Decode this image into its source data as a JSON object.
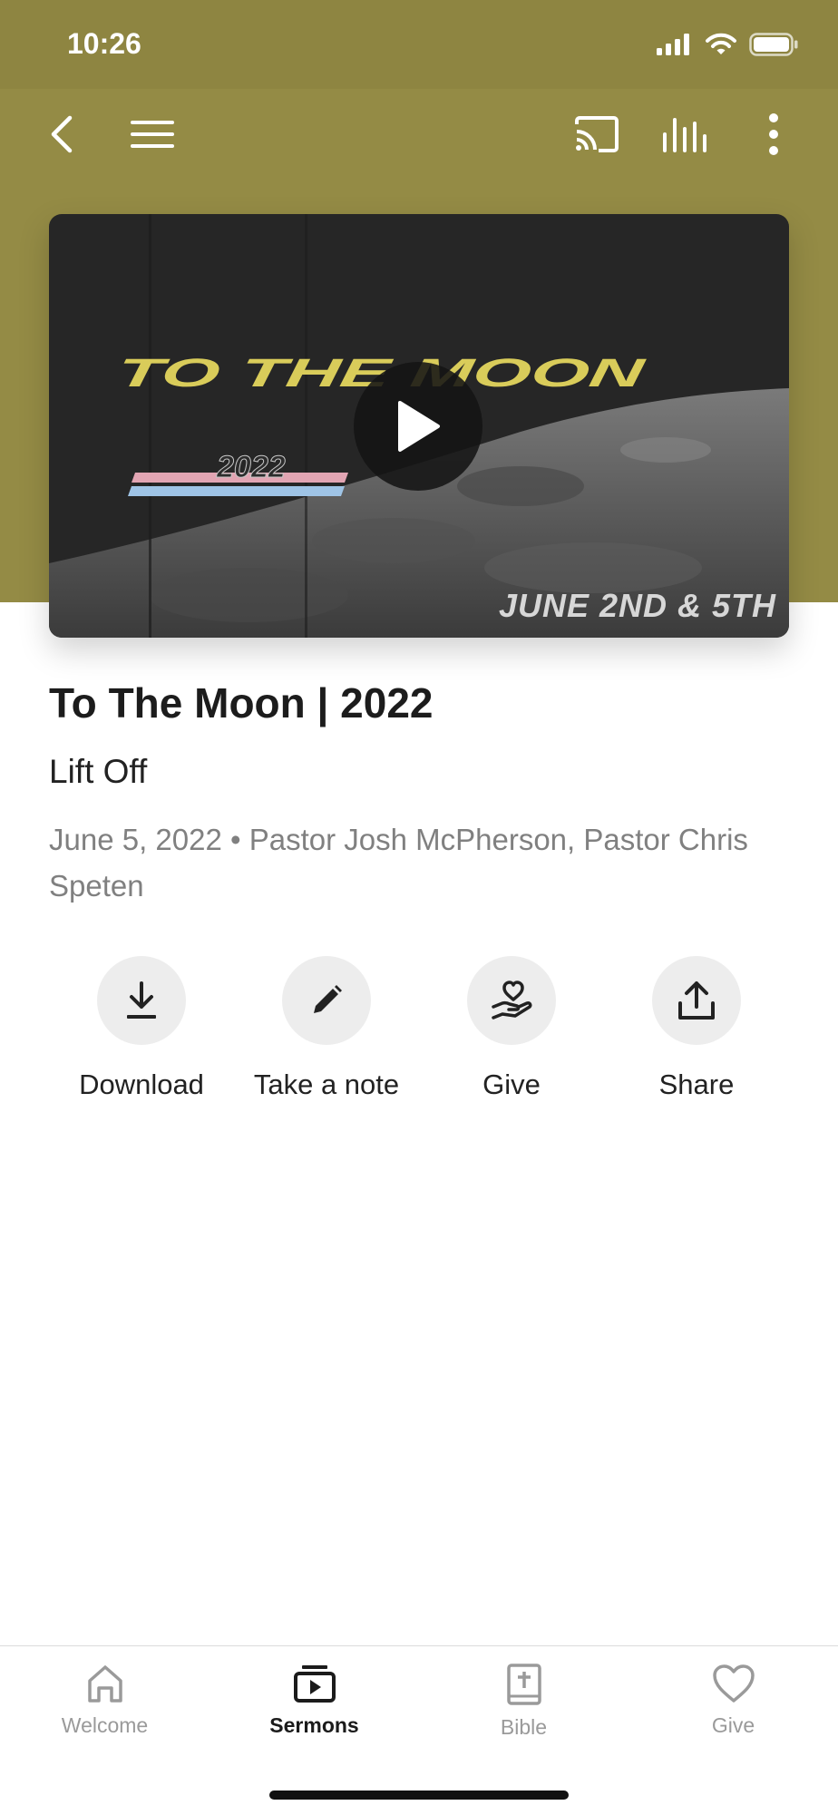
{
  "status_bar": {
    "time": "10:26"
  },
  "toolbar": {
    "icons": [
      "back-icon",
      "menu-icon",
      "cast-icon",
      "audio-levels-icon",
      "more-vertical-icon"
    ]
  },
  "video": {
    "poster_title": "TO THE MOON",
    "poster_year": "2022",
    "date_overlay": "JUNE 2ND & 5TH"
  },
  "sermon": {
    "title": "To The Moon | 2022",
    "subtitle": "Lift Off",
    "meta": "June 5, 2022 • Pastor Josh McPherson, Pastor Chris Speten"
  },
  "actions": [
    {
      "label": "Download",
      "icon": "download-icon"
    },
    {
      "label": "Take a note",
      "icon": "pencil-icon"
    },
    {
      "label": "Give",
      "icon": "give-hand-heart-icon"
    },
    {
      "label": "Share",
      "icon": "share-icon"
    }
  ],
  "tabs": [
    {
      "label": "Welcome",
      "icon": "home-icon"
    },
    {
      "label": "Sermons",
      "icon": "sermons-icon",
      "active": true
    },
    {
      "label": "Bible",
      "icon": "bible-icon"
    },
    {
      "label": "Give",
      "icon": "heart-icon"
    }
  ],
  "colors": {
    "header": "#948b45",
    "status_bar": "#8e8541",
    "poster_yellow": "#d9cc5a"
  }
}
